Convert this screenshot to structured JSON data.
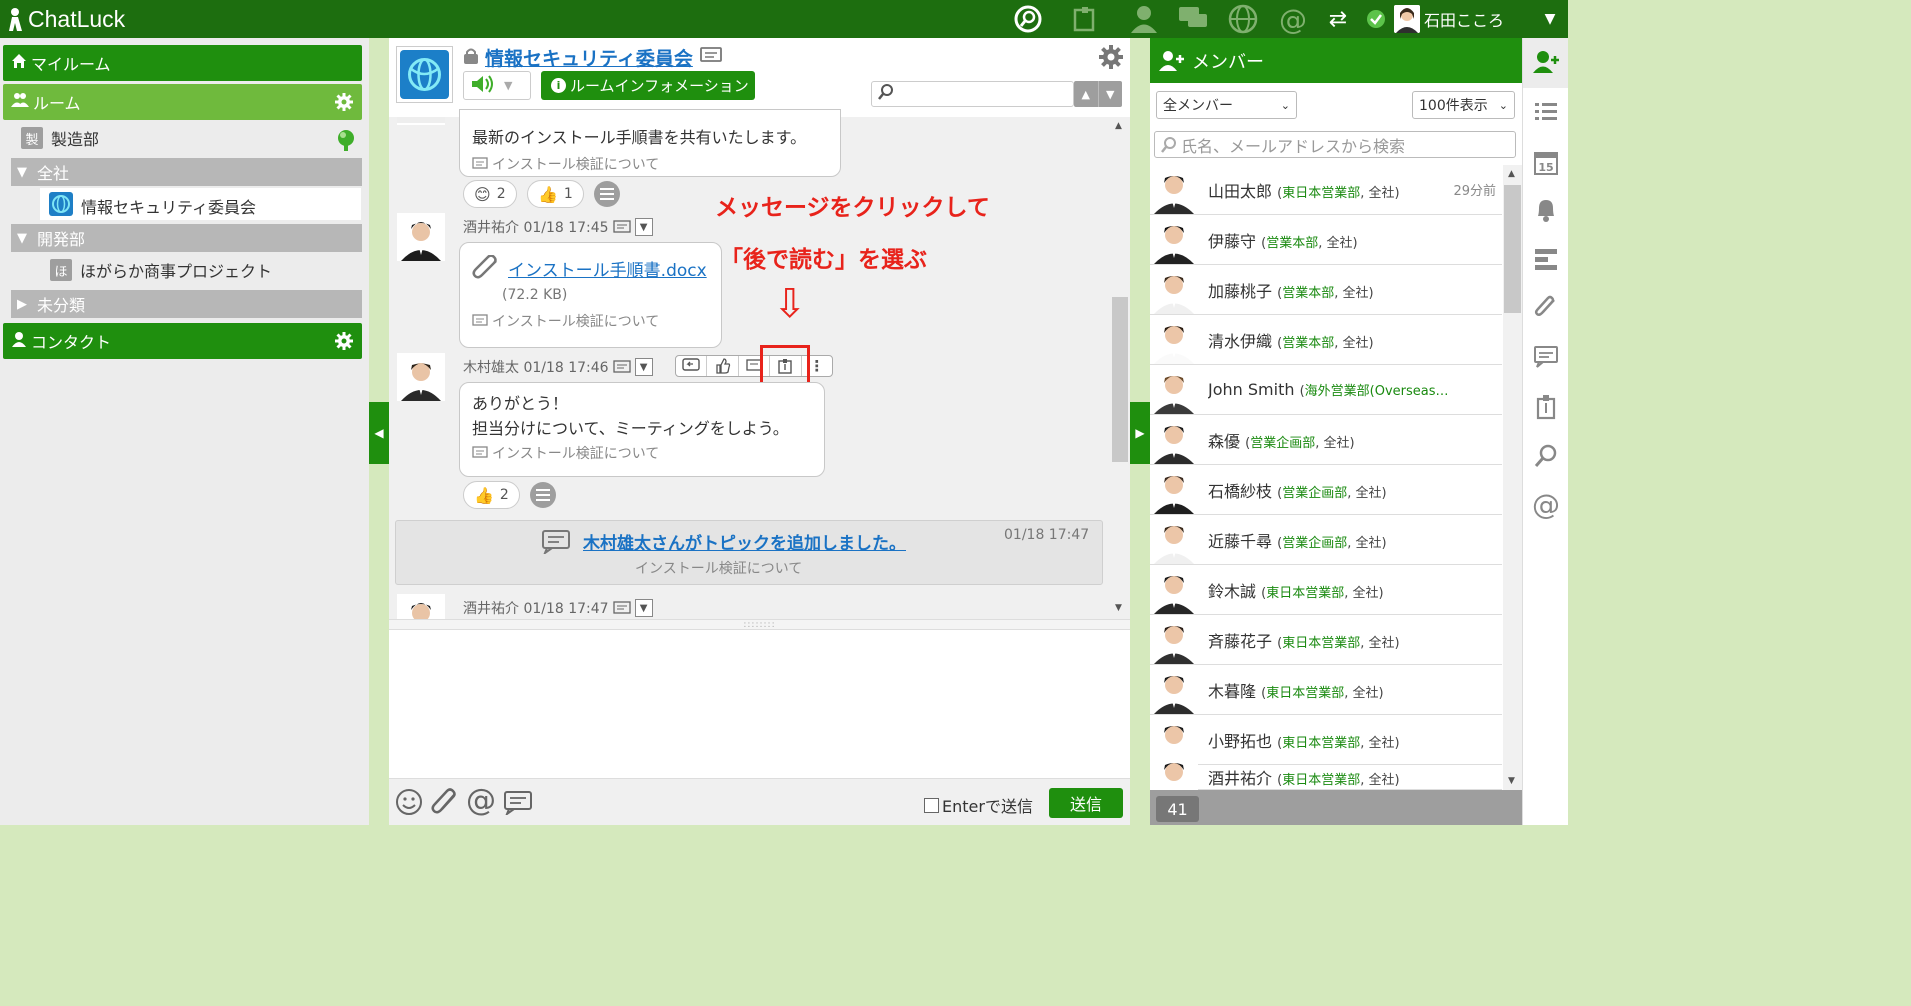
{
  "app": {
    "name": "ChatLuck"
  },
  "header": {
    "user_name": "石田こころ"
  },
  "sidebar": {
    "myroom_label": "マイルーム",
    "room_label": "ルーム",
    "rooms": [
      {
        "badge": "製",
        "label": "製造部"
      }
    ],
    "categories": [
      {
        "label": "全社",
        "items": [
          {
            "label": "情報セキュリティ委員会"
          }
        ]
      },
      {
        "label": "開発部",
        "items": [
          {
            "badge": "ほ",
            "label": "ほがらか商事プロジェクト"
          }
        ]
      },
      {
        "label": "未分類"
      }
    ],
    "contact_label": "コンタクト"
  },
  "room": {
    "title": "情報セキュリティ委員会",
    "info_button": "ルームインフォメーション",
    "search_placeholder": ""
  },
  "messages": [
    {
      "text": "最新のインストール手順書を共有いたします。",
      "topic": "インストール検証について",
      "reactions": [
        {
          "emoji": "😊",
          "count": "2"
        },
        {
          "emoji": "👍",
          "count": "1"
        }
      ]
    },
    {
      "author_time": "酒井祐介 01/18 17:45",
      "file_name": "インストール手順書.docx",
      "file_size": "(72.2 KB)",
      "topic": "インストール検証について"
    },
    {
      "author_time": "木村雄太 01/18 17:46",
      "line1": "ありがとう！",
      "line2": "担当分けについて、ミーティングをしよう。",
      "topic": "インストール検証について",
      "reactions": [
        {
          "emoji": "👍",
          "count": "2"
        }
      ]
    },
    {
      "system_text": "木村雄太さんがトピックを追加しました。",
      "system_time": "01/18 17:47",
      "system_sub": "インストール検証について"
    },
    {
      "author_time": "酒井祐介 01/18 17:47"
    }
  ],
  "annotation": {
    "line1": "メッセージをクリックして",
    "line2": "「後で読む」を選ぶ",
    "arrow": "⇩"
  },
  "composer": {
    "enter_send_label": "Enterで送信",
    "send_button": "送信"
  },
  "members_panel": {
    "title": "メンバー",
    "filter": "全メンバー",
    "page_size": "100件表示",
    "search_placeholder": "氏名、メールアドレスから検索",
    "count": "41",
    "list": [
      {
        "name": "山田太郎",
        "dept": "東日本営業部",
        "rest": ", 全社)",
        "time": "29分前"
      },
      {
        "name": "伊藤守",
        "dept": "営業本部",
        "rest": ", 全社)"
      },
      {
        "name": "加藤桃子",
        "dept": "営業本部",
        "rest": ", 全社)"
      },
      {
        "name": "清水伊織",
        "dept": "営業本部",
        "rest": ", 全社)"
      },
      {
        "name": "John Smith",
        "dept": "海外営業部(Overseas…",
        "rest": ""
      },
      {
        "name": "森優",
        "dept": "営業企画部",
        "rest": ", 全社)"
      },
      {
        "name": "石橋紗枝",
        "dept": "営業企画部",
        "rest": ", 全社)"
      },
      {
        "name": "近藤千尋",
        "dept": "営業企画部",
        "rest": ", 全社)"
      },
      {
        "name": "鈴木誠",
        "dept": "東日本営業部",
        "rest": ", 全社)"
      },
      {
        "name": "斉藤花子",
        "dept": "東日本営業部",
        "rest": ", 全社)"
      },
      {
        "name": "木暮隆",
        "dept": "東日本営業部",
        "rest": ", 全社)"
      },
      {
        "name": "小野拓也",
        "dept": "東日本営業部",
        "rest": ", 全社)"
      },
      {
        "name": "酒井祐介",
        "dept": "東日本営業部",
        "rest": ", 全社)"
      }
    ]
  },
  "colors": {
    "brand_dark": "#1d6e0f",
    "brand": "#1f8f0e",
    "accent_red": "#e8231b"
  }
}
